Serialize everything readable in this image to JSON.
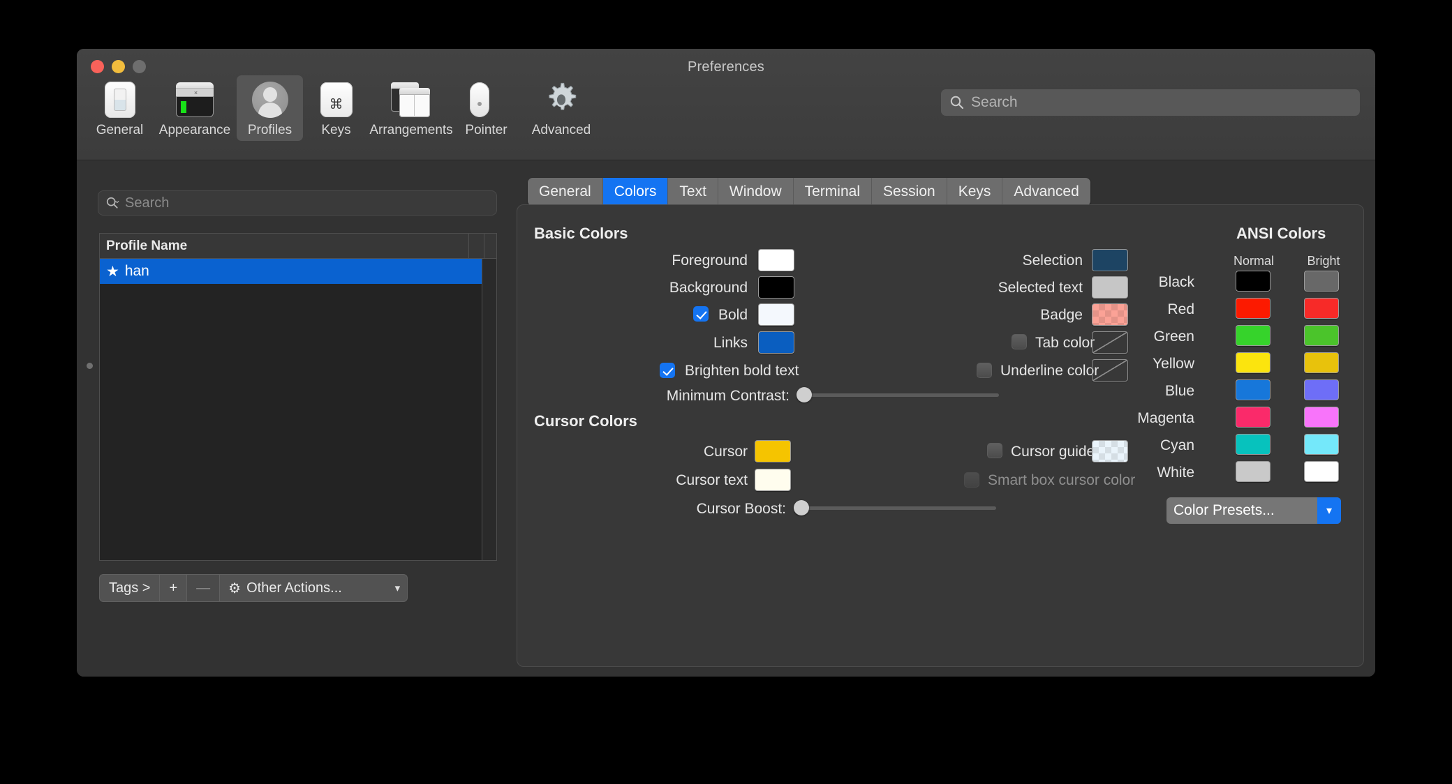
{
  "window": {
    "title": "Preferences",
    "traffic_lights": [
      "close",
      "minimize",
      "zoom"
    ]
  },
  "toolbar": {
    "items": [
      {
        "label": "General",
        "icon": "general-switch-icon"
      },
      {
        "label": "Appearance",
        "icon": "appearance-window-icon"
      },
      {
        "label": "Profiles",
        "icon": "profiles-person-icon"
      },
      {
        "label": "Keys",
        "icon": "keys-command-icon"
      },
      {
        "label": "Arrangements",
        "icon": "arrangements-windows-icon"
      },
      {
        "label": "Pointer",
        "icon": "pointer-mouse-icon"
      },
      {
        "label": "Advanced",
        "icon": "advanced-gear-icon"
      }
    ],
    "selected": "Profiles",
    "search": {
      "placeholder": "Search",
      "value": "",
      "icon": "search-icon"
    }
  },
  "profiles_pane": {
    "search": {
      "placeholder": "Search",
      "value": "",
      "icon": "search-icon"
    },
    "table": {
      "columns": [
        "Profile Name"
      ],
      "rows": [
        {
          "name": "han",
          "default": true,
          "selected": true,
          "icon": "star-icon"
        }
      ]
    },
    "bottom_bar": {
      "tags_label": "Tags >",
      "add_label": "+",
      "remove_label": "—",
      "other_actions_label": "Other Actions...",
      "other_actions_icon": "gear-icon",
      "chevron_icon": "chevron-down-icon"
    }
  },
  "profile_tabs": {
    "items": [
      "General",
      "Colors",
      "Text",
      "Window",
      "Terminal",
      "Session",
      "Keys",
      "Advanced"
    ],
    "active": "Colors"
  },
  "colors": {
    "basic_title": "Basic Colors",
    "cursor_title": "Cursor Colors",
    "ansi_title": "ANSI Colors",
    "left_rows": [
      {
        "label": "Foreground",
        "color": "#ffffff",
        "checkbox": null
      },
      {
        "label": "Background",
        "color": "#000000",
        "checkbox": null
      },
      {
        "label": "Bold",
        "color": "#f4f8fd",
        "checkbox": "checked"
      },
      {
        "label": "Links",
        "color": "#0a5ec0",
        "checkbox": null
      }
    ],
    "right_rows": [
      {
        "label": "Selection",
        "color": "#1d4463",
        "checkbox": null,
        "style": "solid"
      },
      {
        "label": "Selected text",
        "color": "#c6c6c6",
        "checkbox": null,
        "style": "solid"
      },
      {
        "label": "Badge",
        "color": "#fba296",
        "checkbox": null,
        "style": "checker"
      },
      {
        "label": "Tab color",
        "color": null,
        "checkbox": "unchecked",
        "style": "none"
      },
      {
        "label": "Underline color",
        "color": null,
        "checkbox": "unchecked",
        "style": "none"
      }
    ],
    "brighten_bold_label": "Brighten bold text",
    "brighten_bold_checked": true,
    "minimum_contrast_label": "Minimum Contrast:",
    "minimum_contrast_value": 0,
    "cursor_rows": [
      {
        "label": "Cursor",
        "color": "#f5c400",
        "style": "solid"
      },
      {
        "label": "Cursor text",
        "color": "#fffdee",
        "style": "solid"
      }
    ],
    "cursor_guide_label": "Cursor guide",
    "cursor_guide_checked": false,
    "cursor_guide_color": "#eaf4fb",
    "smart_box_label": "Smart box cursor color",
    "smart_box_checked": false,
    "smart_box_disabled": true,
    "cursor_boost_label": "Cursor Boost:",
    "cursor_boost_value": 0,
    "ansi_headers": [
      "Normal",
      "Bright"
    ],
    "ansi_rows": [
      {
        "name": "Black",
        "normal": "#000000",
        "bright": "#686868"
      },
      {
        "name": "Red",
        "normal": "#fc1a00",
        "bright": "#f72a28"
      },
      {
        "name": "Green",
        "normal": "#36d32b",
        "bright": "#4bc42b"
      },
      {
        "name": "Yellow",
        "normal": "#fbe40e",
        "bright": "#e8c20c"
      },
      {
        "name": "Blue",
        "normal": "#1777da",
        "bright": "#6e6ef7"
      },
      {
        "name": "Magenta",
        "normal": "#fa2a6a",
        "bright": "#f874fa"
      },
      {
        "name": "Cyan",
        "normal": "#07c2bd",
        "bright": "#74e8fa"
      },
      {
        "name": "White",
        "normal": "#c9c9c9",
        "bright": "#ffffff"
      }
    ],
    "presets_label": "Color Presets...",
    "presets_chevron_icon": "chevron-down-icon"
  }
}
